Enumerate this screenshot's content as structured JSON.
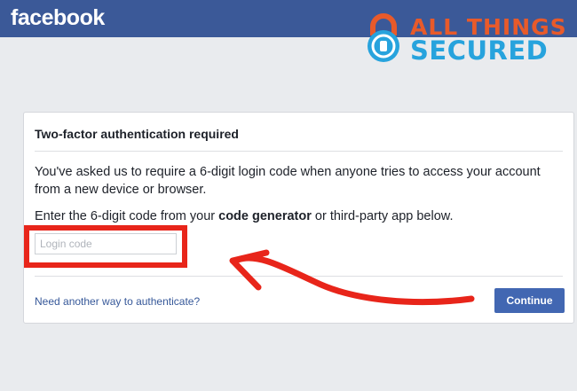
{
  "header": {
    "brand": "facebook"
  },
  "watermark": {
    "line1": "ALL THINGS",
    "line2": "SECURED",
    "icon": "lock-icon"
  },
  "card": {
    "title": "Two-factor authentication required",
    "description": "You've asked us to require a 6-digit login code when anyone tries to access your account from a new device or browser.",
    "instruction_before": "Enter the 6-digit code from your ",
    "instruction_bold": "code generator",
    "instruction_after": " or third-party app below.",
    "input_placeholder": "Login code",
    "input_value": "",
    "another_way_link": "Need another way to authenticate?",
    "continue_label": "Continue"
  },
  "colors": {
    "header_bg": "#3b5998",
    "page_bg": "#e9ebee",
    "highlight": "#e8251a",
    "button_bg": "#4267b2",
    "link": "#365899",
    "watermark_orange": "#e85a2a",
    "watermark_blue": "#27a3dd"
  }
}
